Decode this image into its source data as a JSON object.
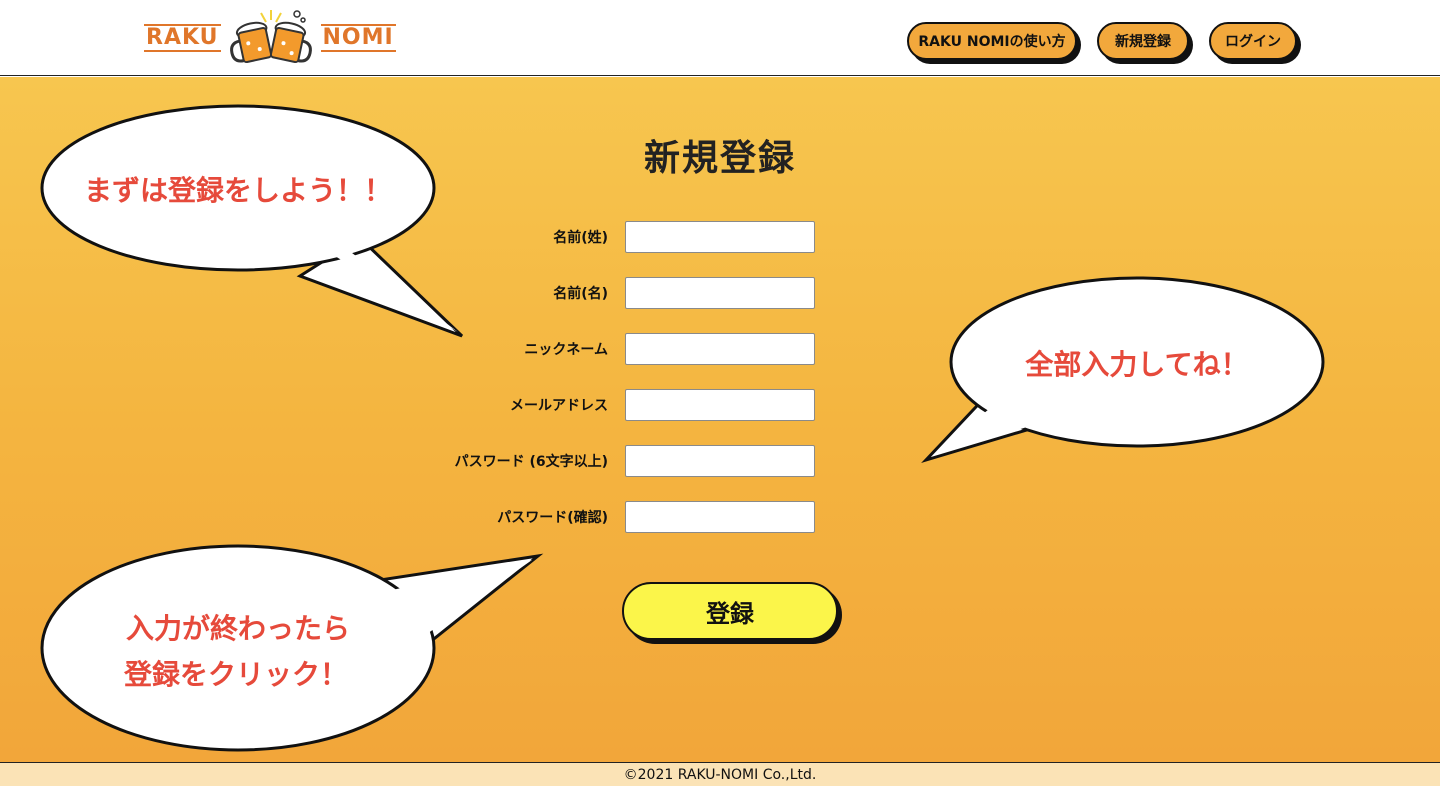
{
  "header": {
    "logo": {
      "left_word": "RAKU",
      "right_word": "NOMI"
    },
    "nav": [
      {
        "label": "RAKU NOMIの使い方"
      },
      {
        "label": "新規登録"
      },
      {
        "label": "ログイン"
      }
    ]
  },
  "main": {
    "title": "新規登録",
    "fields": [
      {
        "label": "名前(姓)",
        "value": ""
      },
      {
        "label": "名前(名)",
        "value": ""
      },
      {
        "label": "ニックネーム",
        "value": ""
      },
      {
        "label": "メールアドレス",
        "value": ""
      },
      {
        "label": "パスワード (6文字以上)",
        "value": ""
      },
      {
        "label": "パスワード(確認)",
        "value": ""
      }
    ],
    "submit_label": "登録"
  },
  "bubbles": {
    "top_left": "まずは登録をしよう！！",
    "right": "全部入力してね！",
    "bottom_left_line1": "入力が終わったら",
    "bottom_left_line2": "登録をクリック！"
  },
  "footer": {
    "copyright": "©2021 RAKU-NOMI Co.,Ltd."
  },
  "colors": {
    "accent_orange": "#f2a83c",
    "logo_orange": "#e0762a",
    "bubble_text_red": "#e64a3b",
    "submit_yellow": "#fbf54a",
    "footer_bg": "#fbe3b6"
  }
}
